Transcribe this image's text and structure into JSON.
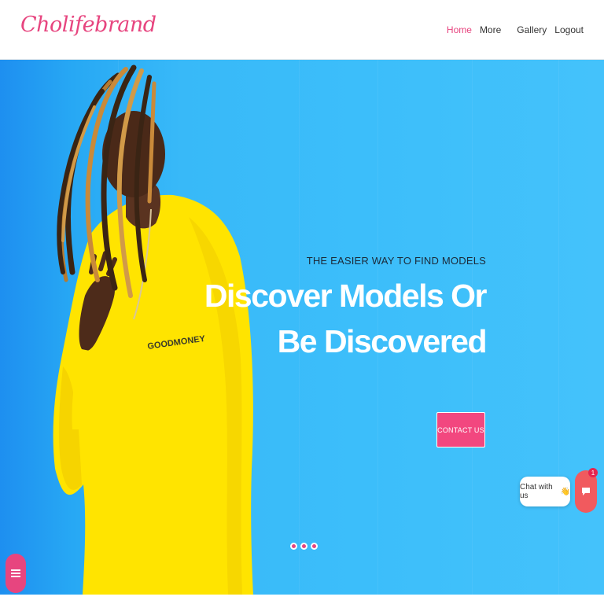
{
  "header": {
    "logo_text": "Cholifebrand",
    "nav": {
      "home": "Home",
      "more": "More",
      "gallery": "Gallery",
      "logout": "Logout"
    }
  },
  "hero": {
    "subtitle": "THE EASIER WAY TO FIND MODELS",
    "headline_line1": "Discover Models Or",
    "headline_line2": "Be Discovered",
    "cta_label": "CONTACT US",
    "shirt_text": "GOODMONEY",
    "slide_count": 3,
    "active_slide": 1
  },
  "chat": {
    "label": "Chat with us",
    "wave_glyph": "👋",
    "badge_count": "1"
  },
  "colors": {
    "brand_pink": "#e7457f",
    "hero_blue": "#3cbefa",
    "shirt_yellow": "#ffe600",
    "chat_red": "#f15a5e"
  },
  "icons": {
    "menu": "hamburger-menu-icon",
    "chat": "chat-bubble-icon"
  }
}
